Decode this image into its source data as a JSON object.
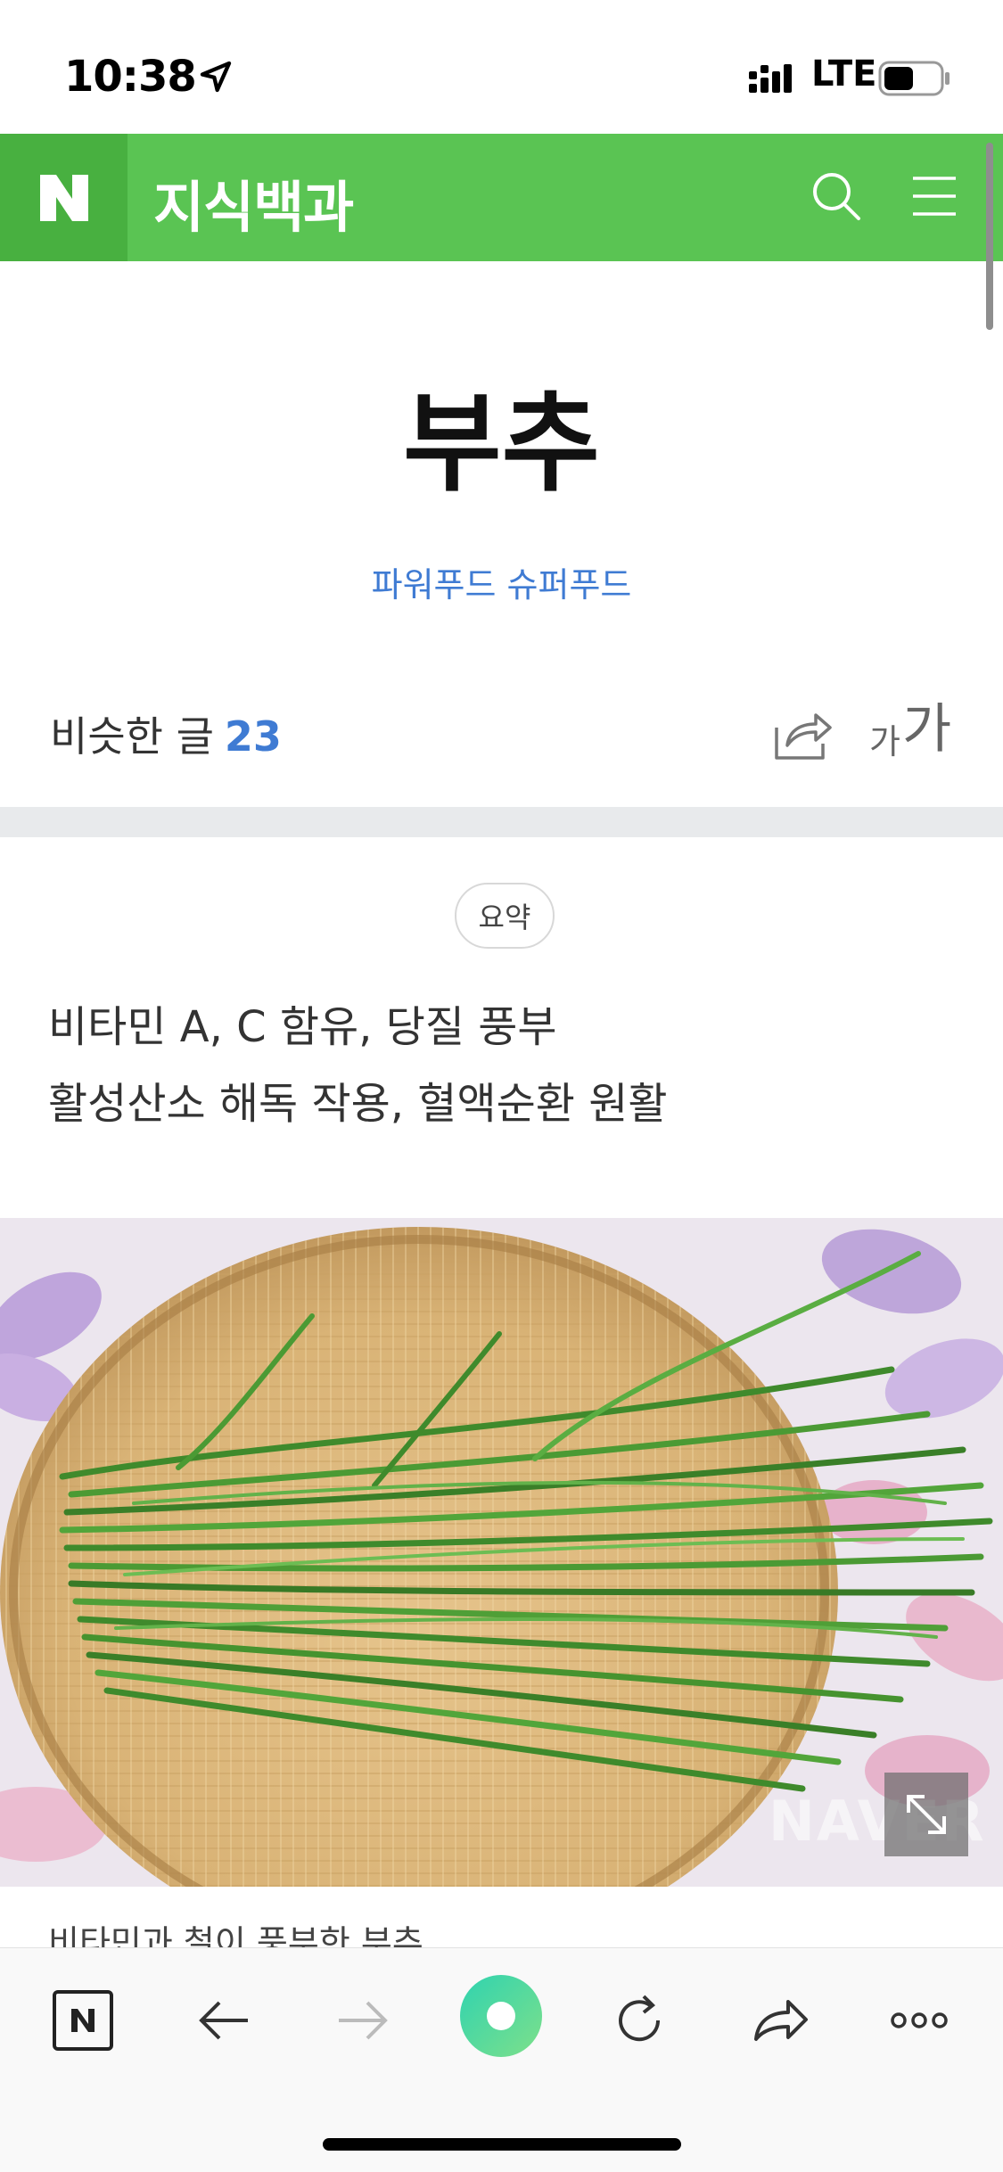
{
  "status_bar": {
    "time": "10:38",
    "network": "LTE",
    "icons": [
      "location-arrow-icon",
      "signal-icon",
      "battery-icon"
    ]
  },
  "header": {
    "logo": "N",
    "title": "지식백과",
    "background": "#5ac453",
    "icons": [
      "search-icon",
      "menu-icon"
    ]
  },
  "article": {
    "title": "부추",
    "category": "파워푸드 슈퍼푸드",
    "similar_label": "비슷한 글",
    "similar_count": "23",
    "font_small": "가",
    "font_large": "가"
  },
  "summary": {
    "badge": "요약",
    "line1": "비타민 A, C 함유, 당질 풍부",
    "line2": "활성산소 해독 작용, 혈액순환 원활"
  },
  "image": {
    "watermark": "NAVER",
    "caption": "비타민과 철이 풍부한 부추"
  },
  "toolbar": {
    "icons": [
      "naver-home-icon",
      "back-arrow-icon",
      "forward-arrow-icon",
      "green-dot-icon",
      "refresh-icon",
      "share-arrow-icon",
      "more-icon"
    ],
    "accent": "#4fd5a4"
  }
}
